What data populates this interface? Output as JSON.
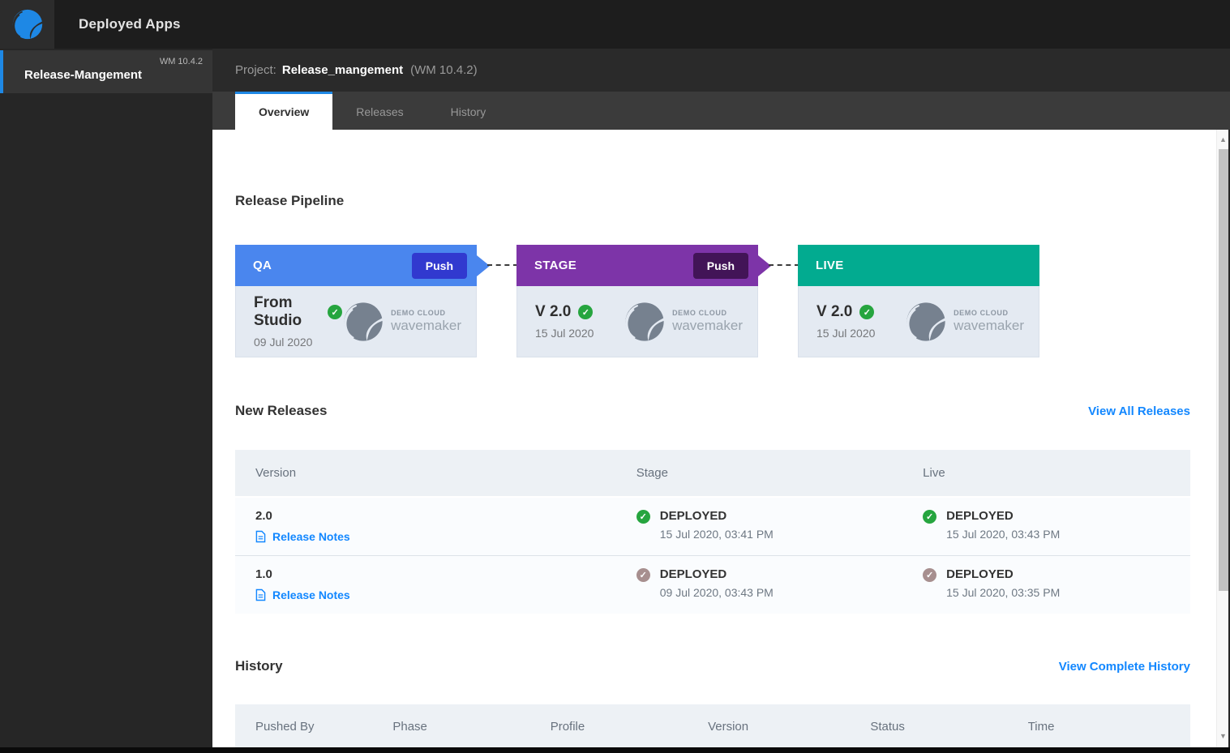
{
  "colors": {
    "accent_blue": "#1e88e5",
    "link_blue": "#1287ff"
  },
  "topbar": {
    "title": "Deployed Apps"
  },
  "sidebar": {
    "selected_app": {
      "name": "Release-Mangement",
      "platform_version": "WM 10.4.2"
    }
  },
  "project_bar": {
    "label": "Project:",
    "name": "Release_mangement",
    "platform_version": "(WM 10.4.2)"
  },
  "tabs": [
    {
      "label": "Overview",
      "active": true
    },
    {
      "label": "Releases",
      "active": false
    },
    {
      "label": "History",
      "active": false
    }
  ],
  "pipeline": {
    "heading": "Release Pipeline",
    "phases": [
      {
        "name": "QA",
        "push_label": "Push",
        "version": "From Studio",
        "date": "09 Jul 2020",
        "header_color": "#4a86ee",
        "push_color": "#3139cf",
        "status_color": "#26a53f",
        "cloud_label": "DEMO CLOUD",
        "cloud_name": "wavemaker"
      },
      {
        "name": "STAGE",
        "push_label": "Push",
        "version": "V 2.0",
        "date": "15 Jul 2020",
        "header_color": "#7d34a8",
        "push_color": "#421457",
        "status_color": "#26a53f",
        "cloud_label": "DEMO CLOUD",
        "cloud_name": "wavemaker"
      },
      {
        "name": "LIVE",
        "version": "V 2.0",
        "date": "15 Jul 2020",
        "header_color": "#02ab90",
        "status_color": "#26a53f",
        "cloud_label": "DEMO CLOUD",
        "cloud_name": "wavemaker"
      }
    ]
  },
  "new_releases": {
    "heading": "New Releases",
    "view_all_label": "View All Releases",
    "columns": [
      "Version",
      "Stage",
      "Live"
    ],
    "rows": [
      {
        "version": "2.0",
        "notes_label": "Release Notes",
        "stage": {
          "status": "DEPLOYED",
          "time": "15 Jul 2020, 03:41 PM",
          "icon_color": "#26a53f"
        },
        "live": {
          "status": "DEPLOYED",
          "time": "15 Jul 2020, 03:43 PM",
          "icon_color": "#26a53f"
        }
      },
      {
        "version": "1.0",
        "notes_label": "Release Notes",
        "stage": {
          "status": "DEPLOYED",
          "time": "09 Jul 2020, 03:43 PM",
          "icon_color": "#a78f8f"
        },
        "live": {
          "status": "DEPLOYED",
          "time": "15 Jul 2020, 03:35 PM",
          "icon_color": "#a78f8f"
        }
      }
    ]
  },
  "history": {
    "heading": "History",
    "view_all_label": "View Complete History",
    "columns": [
      "Pushed By",
      "Phase",
      "Profile",
      "Version",
      "Status",
      "Time"
    ]
  }
}
